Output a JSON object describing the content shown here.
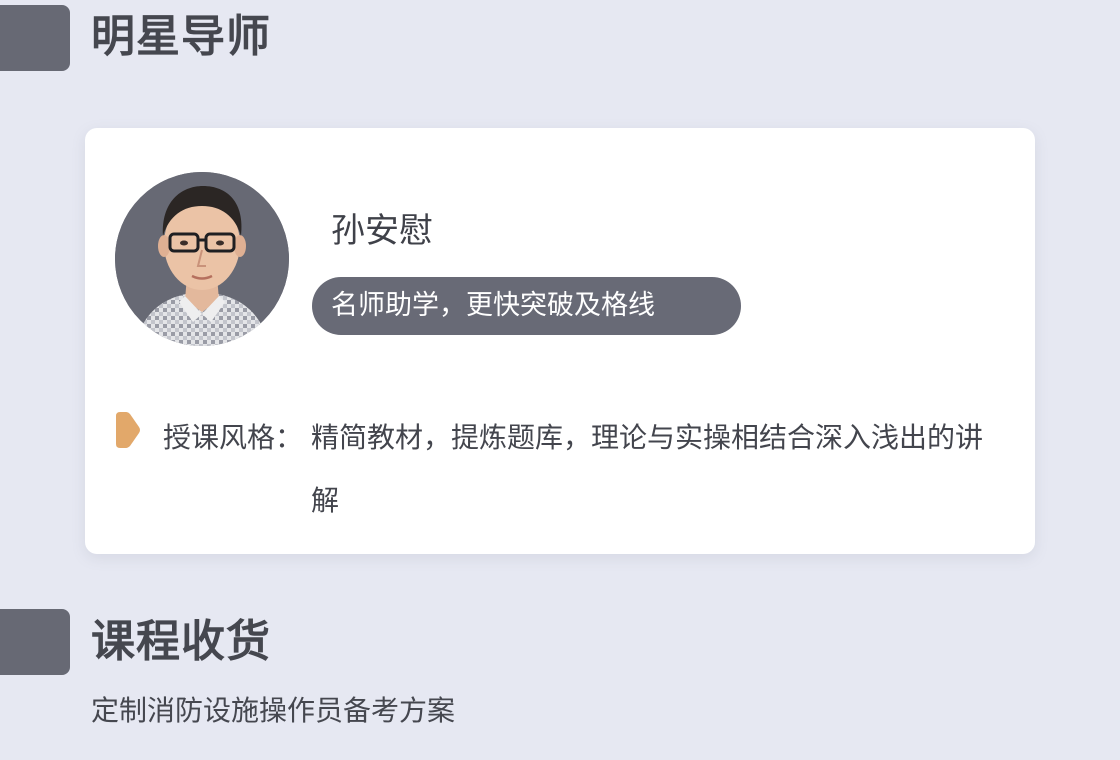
{
  "sections": {
    "teacher": {
      "title": "明星导师"
    },
    "gains": {
      "title": "课程收货",
      "subtitle": "定制消防设施操作员备考方案"
    }
  },
  "teacher": {
    "name": "孙安慰",
    "slogan": "名师助学，更快突破及格线",
    "style_label": "授课风格：",
    "style_text": "精简教材，提炼题库，理论与实操相结合深入浅出的讲解"
  },
  "colors": {
    "background": "#e6e8f2",
    "marker": "#676974",
    "pill": "#686a76",
    "bullet": "#e2a86a",
    "card": "#ffffff"
  },
  "icons": {
    "bullet": "play-triangle-icon",
    "avatar": "teacher-portrait"
  }
}
